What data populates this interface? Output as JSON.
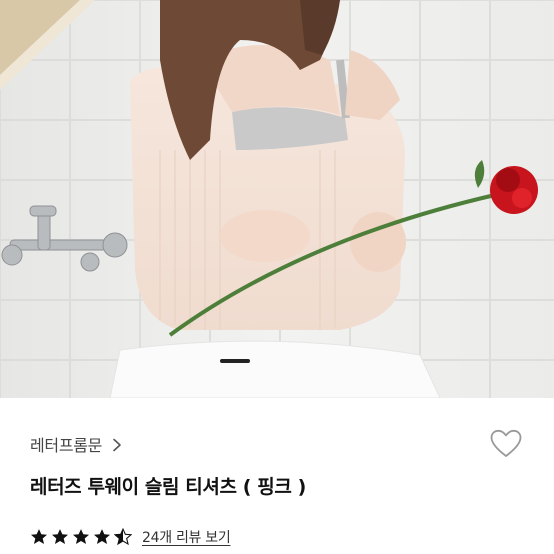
{
  "product": {
    "brand": "레터프롬문",
    "title": "레터즈 투웨이 슬림 티셔츠 ( 핑크 )",
    "review_link": "24개 리뷰 보기",
    "rating_stars": 4.5
  },
  "icons": {
    "brand_chevron": "chevron-right-icon",
    "like": "heart-outline-icon",
    "star_full": "star-icon",
    "star_half": "star-half-icon"
  },
  "gallery": {
    "current_index": 1
  },
  "colors": {
    "star": "#111111",
    "heart_stroke": "#999999",
    "pager": "#222222"
  }
}
